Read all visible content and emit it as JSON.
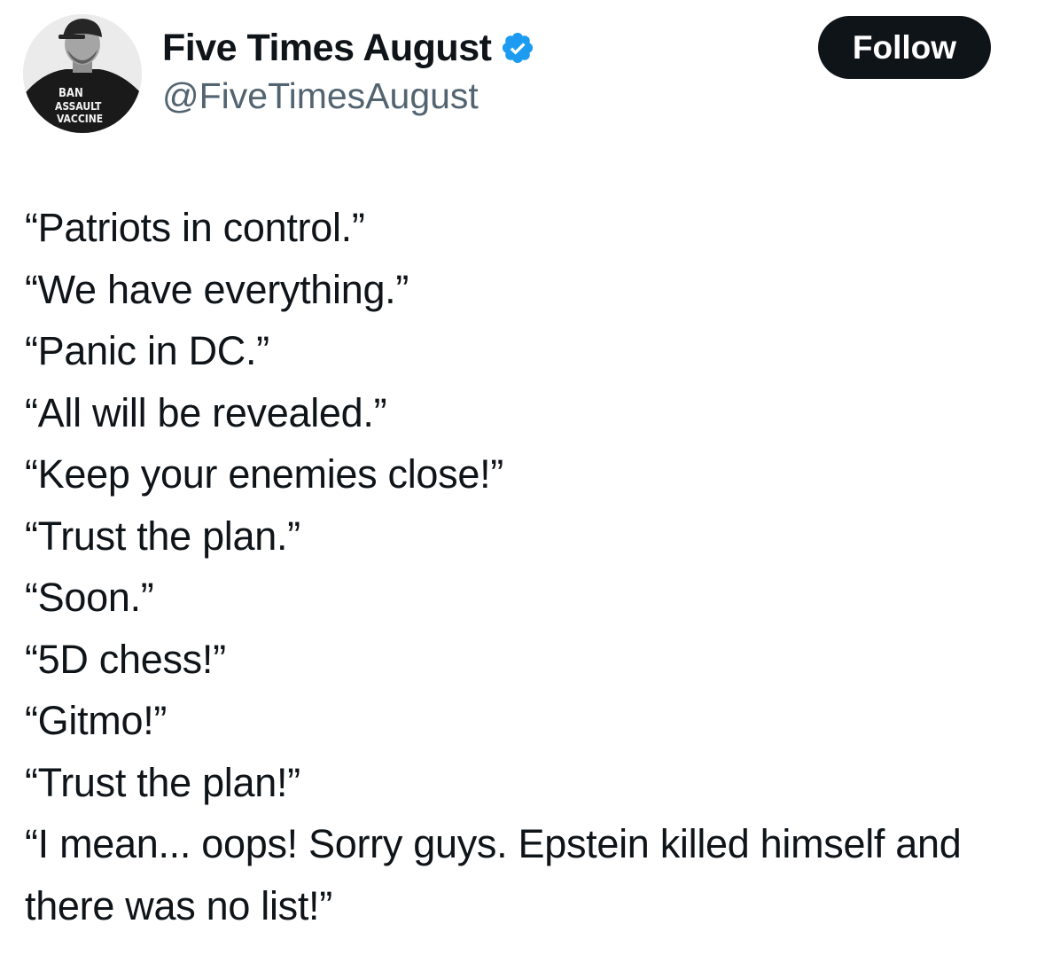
{
  "author": {
    "display_name": "Five Times August",
    "handle": "@FiveTimesAugust",
    "verified_icon": "verified-badge-icon",
    "avatar_shirt_text": [
      "BAN",
      "ASSAULT",
      "VACCINE"
    ]
  },
  "actions": {
    "follow_label": "Follow"
  },
  "tweet": {
    "lines": [
      "“Patriots in control.”",
      "“We have everything.”",
      "“Panic in DC.”",
      "“All will be revealed.”",
      "“Keep your enemies close!”",
      "“Trust the plan.”",
      "“Soon.”",
      "“5D chess!”",
      "“Gitmo!”",
      "“Trust the plan!”",
      "“I mean... oops! Sorry guys. Epstein killed himself and there was no list!”"
    ]
  },
  "colors": {
    "text": "#0f1419",
    "secondary_text": "#536471",
    "verified_blue": "#1d9bf0",
    "button_bg": "#0f1419",
    "button_text": "#ffffff"
  }
}
